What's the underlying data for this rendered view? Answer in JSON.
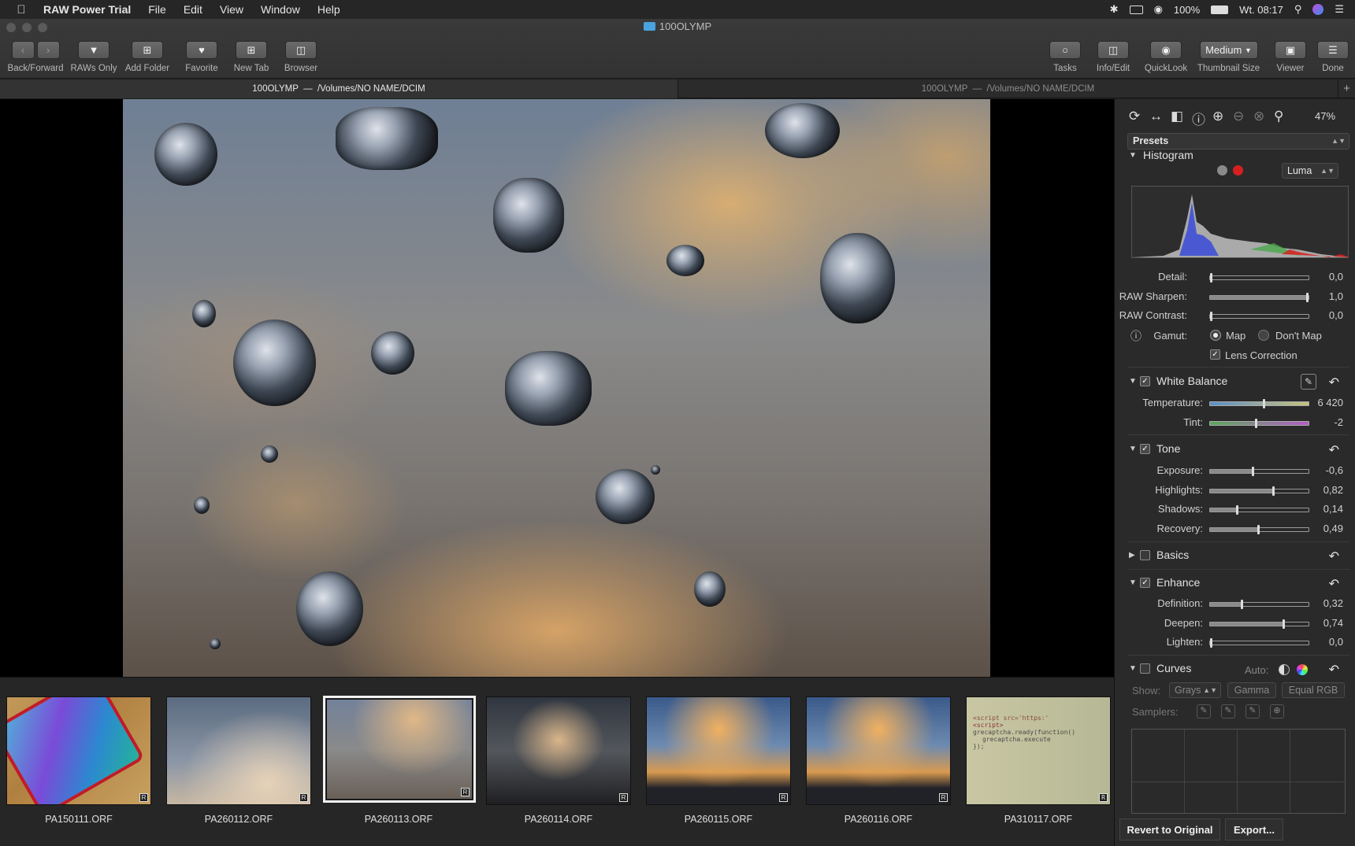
{
  "menubar": {
    "apple": "",
    "app_name": "RAW Power Trial",
    "menus": [
      "File",
      "Edit",
      "View",
      "Window",
      "Help"
    ],
    "battery": "100%",
    "datetime": "Wt. 08:17"
  },
  "window": {
    "title": "100OLYMP"
  },
  "toolbar": {
    "back_forward": "Back/Forward",
    "raws_only": "RAWs Only",
    "add_folder": "Add Folder",
    "favorite": "Favorite",
    "new_tab": "New Tab",
    "browser": "Browser",
    "tasks": "Tasks",
    "info_edit": "Info/Edit",
    "quicklook": "QuickLook",
    "thumbnail_size": "Thumbnail Size",
    "thumbnail_size_value": "Medium",
    "viewer": "Viewer",
    "done": "Done"
  },
  "tabs": [
    {
      "folder": "100OLYMP",
      "sep": "—",
      "path": "/Volumes/NO NAME/DCIM",
      "active": true
    },
    {
      "folder": "100OLYMP",
      "sep": "—",
      "path": "/Volumes/NO NAME/DCIM",
      "active": false
    }
  ],
  "add_tab": "+",
  "filmstrip": [
    {
      "name": "PA150111.ORF",
      "badge": "R",
      "selected": false
    },
    {
      "name": "PA260112.ORF",
      "badge": "R",
      "selected": false
    },
    {
      "name": "PA260113.ORF",
      "badge": "R",
      "selected": true
    },
    {
      "name": "PA260114.ORF",
      "badge": "R",
      "selected": false
    },
    {
      "name": "PA260115.ORF",
      "badge": "R",
      "selected": false
    },
    {
      "name": "PA260116.ORF",
      "badge": "R",
      "selected": false
    },
    {
      "name": "PA310117.ORF",
      "badge": "R",
      "selected": false
    }
  ],
  "thumb_code_lines": [
    "<script src='https:'",
    "<script>",
    "grecaptcha.ready(function()",
    "grecaptcha.execute",
    "});"
  ],
  "panel": {
    "zoom": "47%",
    "presets": "Presets",
    "histogram": {
      "title": "Histogram",
      "mode": "Luma"
    },
    "raw": [
      {
        "label": "Detail:",
        "value": "0,0",
        "level": 0.0
      },
      {
        "label": "RAW Sharpen:",
        "value": "1,0",
        "level": 1.0
      },
      {
        "label": "RAW Contrast:",
        "value": "0,0",
        "level": 0.0
      }
    ],
    "gamut": {
      "label": "Gamut:",
      "opt1": "Map",
      "opt2": "Don't Map",
      "selected": "Map"
    },
    "lens_correction": "Lens Correction",
    "white_balance": {
      "title": "White Balance",
      "temperature": {
        "label": "Temperature:",
        "value": "6 420",
        "level": 0.54
      },
      "tint": {
        "label": "Tint:",
        "value": "-2",
        "level": 0.46
      }
    },
    "tone": {
      "title": "Tone",
      "rows": [
        {
          "label": "Exposure:",
          "value": "-0,6",
          "level": 0.43
        },
        {
          "label": "Highlights:",
          "value": "0,82",
          "level": 0.64
        },
        {
          "label": "Shadows:",
          "value": "0,14",
          "level": 0.27
        },
        {
          "label": "Recovery:",
          "value": "0,49",
          "level": 0.49
        }
      ]
    },
    "basics": {
      "title": "Basics"
    },
    "enhance": {
      "title": "Enhance",
      "rows": [
        {
          "label": "Definition:",
          "value": "0,32",
          "level": 0.32
        },
        {
          "label": "Deepen:",
          "value": "0,74",
          "level": 0.74
        },
        {
          "label": "Lighten:",
          "value": "0,0",
          "level": 0.0
        }
      ]
    },
    "curves": {
      "title": "Curves",
      "auto": "Auto:",
      "show": "Show:",
      "grays": "Grays",
      "gamma": "Gamma",
      "equal_rgb": "Equal RGB",
      "samplers": "Samplers:"
    },
    "revert": "Revert to Original",
    "export": "Export..."
  },
  "colors": {
    "accent_red": "#d62020",
    "panel_bg": "#2a2a2a",
    "toolbar_bg": "#363636"
  }
}
